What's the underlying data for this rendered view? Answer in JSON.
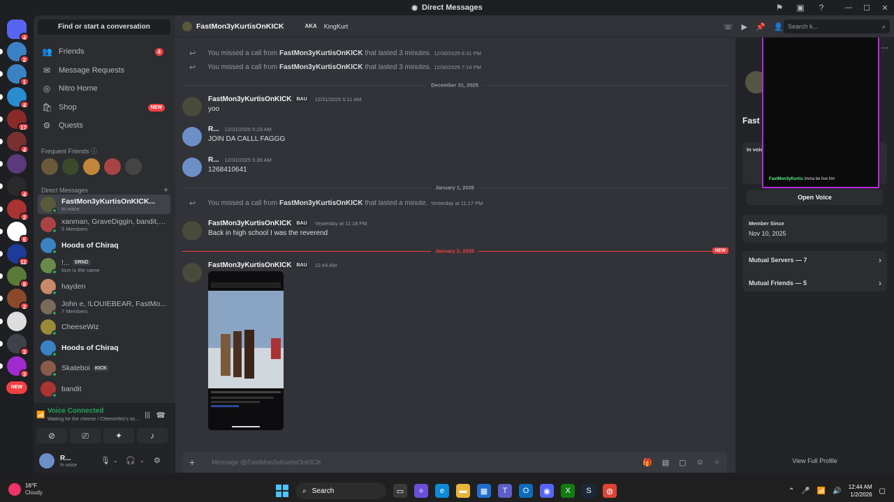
{
  "window": {
    "title": "Direct Messages",
    "controls": [
      "—",
      "☐",
      "✕"
    ]
  },
  "servers": [
    {
      "badge": "4",
      "color": "#5865f2",
      "is_home": true
    },
    {
      "badge": "2",
      "color": "#3b82c4"
    },
    {
      "badge": "1",
      "color": "#3b82c4"
    },
    {
      "badge": "4",
      "color": "#2a8bd1"
    },
    {
      "badge": "17",
      "color": "#8a2a2a"
    },
    {
      "badge": "4",
      "color": "#7a3030"
    },
    {
      "badge": "",
      "color": "#5a3a7a"
    },
    {
      "badge": "4",
      "color": "#2a2a2a"
    },
    {
      "badge": "2",
      "color": "#a33"
    },
    {
      "badge": "5",
      "color": "#fff"
    },
    {
      "badge": "11",
      "color": "#1f3b99"
    },
    {
      "badge": "8",
      "color": "#5a7a3a"
    },
    {
      "badge": "2",
      "color": "#8a4a2a"
    },
    {
      "badge": "",
      "color": "#ddd"
    },
    {
      "badge": "3",
      "color": "#404249"
    },
    {
      "badge": "3",
      "color": "#a02ad0"
    },
    {
      "badge": "NEW",
      "color": "#f23f43"
    }
  ],
  "sidebar": {
    "search_label": "Find or start a conversation",
    "nav": [
      {
        "label": "Friends",
        "icon": "friends-icon",
        "badge": "4"
      },
      {
        "label": "Message Requests",
        "icon": "envelope-icon",
        "badge": ""
      },
      {
        "label": "Nitro Home",
        "icon": "nitro-icon",
        "badge": ""
      },
      {
        "label": "Shop",
        "icon": "shop-icon",
        "badge": "NEW"
      },
      {
        "label": "Quests",
        "icon": "quests-icon",
        "badge": ""
      }
    ],
    "frequent_friends_label": "Frequent Friends",
    "frequent_friends_colors": [
      "#6a5a3a",
      "#3a4a2a",
      "#c2863a",
      "#a44",
      "#444"
    ],
    "dm_header": "Direct Messages",
    "dms": [
      {
        "name": "FastMon3yKurtisOnKICK...",
        "sub": "In voice",
        "bold": true,
        "selected": true,
        "tag": "",
        "color": "#5a5a3a"
      },
      {
        "name": "xanman, GraveDiggin, bandit, ...",
        "sub": "5 Members",
        "bold": false,
        "tag": "",
        "color": "#a44"
      },
      {
        "name": "Hoods of Chiraq",
        "sub": "",
        "bold": true,
        "tag": "",
        "color": "#3b82c4"
      },
      {
        "name": "!...",
        "sub": "tism is the name",
        "bold": false,
        "tag": "SRND",
        "color": "#6a8a4a"
      },
      {
        "name": "hayden",
        "sub": "",
        "bold": false,
        "tag": "",
        "color": "#c98a6a"
      },
      {
        "name": "John e, !LOUIEBEAR, FastMo...",
        "sub": "7 Members",
        "bold": false,
        "tag": "",
        "color": "#7a6a5a"
      },
      {
        "name": "CheeseWiz",
        "sub": "",
        "bold": false,
        "tag": "",
        "color": "#9a8a3a"
      },
      {
        "name": "Hoods of Chiraq",
        "sub": "",
        "bold": true,
        "tag": "",
        "color": "#3b82c4"
      },
      {
        "name": "Skateboi",
        "sub": "",
        "bold": false,
        "tag": "KICK",
        "color": "#8a5a4a"
      },
      {
        "name": "bandit",
        "sub": "",
        "bold": false,
        "tag": "",
        "color": "#a33"
      }
    ]
  },
  "voice": {
    "title": "Voice Connected",
    "channel": "Waiting for the cheese / CheeseWiz's se..."
  },
  "user": {
    "name": "R...",
    "status": "In voice"
  },
  "chat": {
    "header_name": "FastMon3yKurtisOnKICK",
    "aka_label": "AKA",
    "aka_value": "KingKurt",
    "search_placeholder": "Search k...",
    "composer_placeholder": "Message @FastMon3yKurtisOnKICK",
    "system1": {
      "pre": "You missed a call from",
      "who": "FastMon3yKurtisOnKICK",
      "post": "that lasted 3 minutes.",
      "ts": "12/30/2025 6:31 PM"
    },
    "system2": {
      "pre": "You missed a call from",
      "who": "FastMon3yKurtisOnKICK",
      "post": "that lasted 3 minutes.",
      "ts": "12/30/2025 7:14 PM"
    },
    "divider1": "December 31, 2025",
    "msg1": {
      "author": "FastMon3yKurtisOnKICK",
      "tag": "BAU",
      "ts": "12/31/2025 5:11 AM",
      "text": "yoo"
    },
    "msg2": {
      "author": "R...",
      "ts": "12/31/2025 5:23 AM",
      "text": "JOIN DA CALLL FAGGG"
    },
    "msg3": {
      "author": "R...",
      "ts": "12/31/2025 5:39 AM",
      "text": "1268410641"
    },
    "divider2": "January 1, 2026",
    "system3": {
      "pre": "You missed a call from",
      "who": "FastMon3yKurtisOnKICK",
      "post": "that lasted a minute.",
      "ts": "Yesterday at 11:17 PM"
    },
    "msg4": {
      "author": "FastMon3yKurtisOnKICK",
      "tag": "BAU",
      "ts": "Yesterday at 11:18 PM",
      "text": "Back in high school I was the reverend"
    },
    "divider3": "January 2, 2026",
    "new_label": "NEW",
    "msg5": {
      "author": "FastMon3yKurtisOnKICK",
      "tag": "BAU",
      "ts": "12:44 AM"
    }
  },
  "profile": {
    "name": "Fast",
    "in_voice": "In voic",
    "open_voice": "Open Voice",
    "member_since_label": "Member Since",
    "member_since_value": "Nov 10, 2025",
    "mutual_servers": "Mutual Servers — 7",
    "mutual_friends": "Mutual Friends — 5",
    "footer": "View Full Profile"
  },
  "video_popout": {
    "user": "FastMon3yKurtis",
    "text": "imma be live tmr"
  },
  "taskbar": {
    "temp": "16°F",
    "condition": "Cloudy",
    "search": "Search",
    "time": "12:44 AM",
    "date": "1/2/2026"
  }
}
